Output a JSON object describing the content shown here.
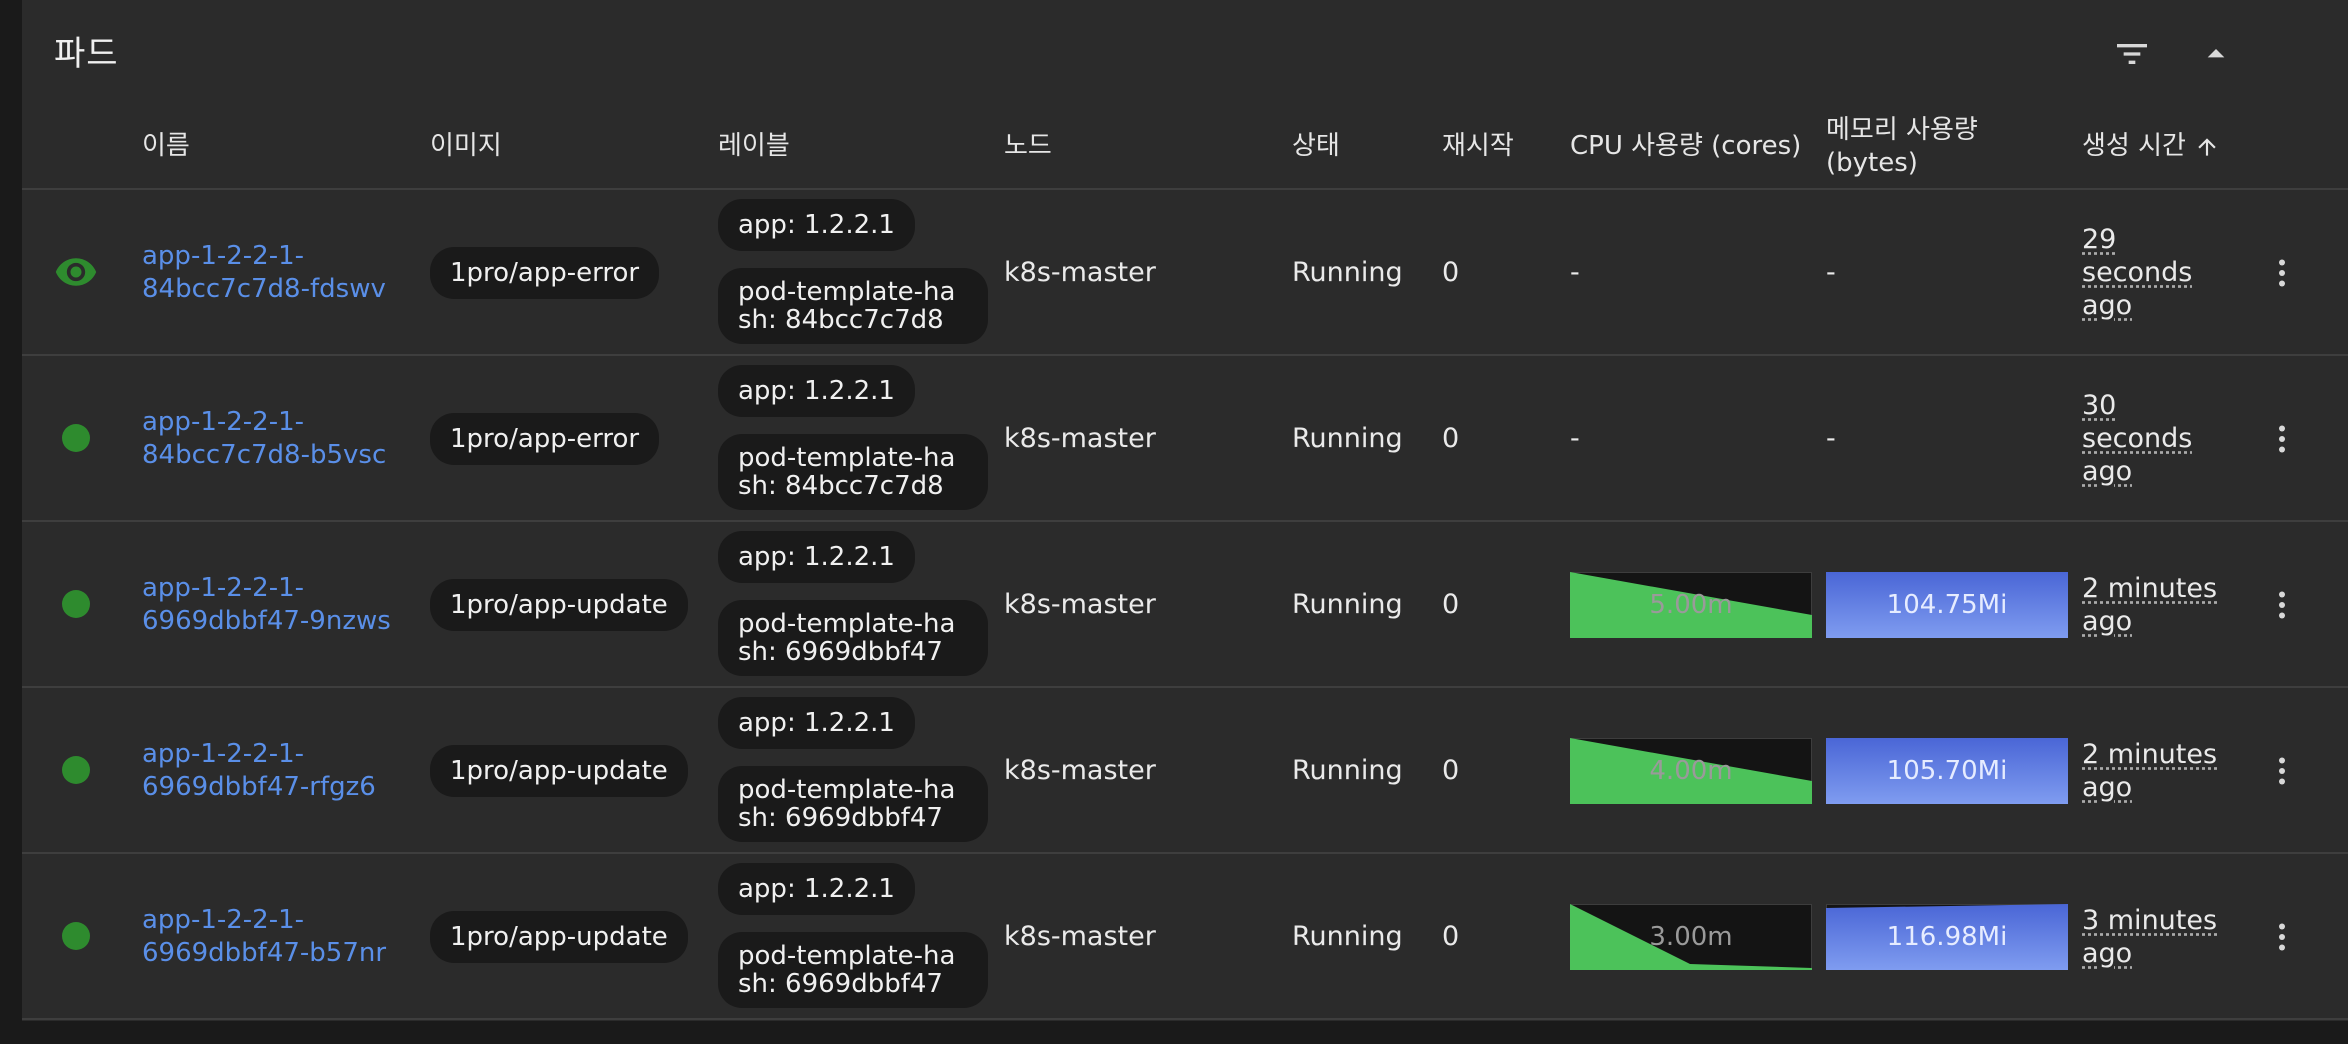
{
  "panel": {
    "title": "파드"
  },
  "header_icons": {
    "filter": "filter-icon",
    "collapse": "chevron-up-icon"
  },
  "columns": {
    "name": "이름",
    "image": "이미지",
    "labels": "레이블",
    "node": "노드",
    "status": "상태",
    "restarts": "재시작",
    "cpu": "CPU 사용량 (cores)",
    "memory_line1": "메모리 사용량",
    "memory_line2": "(bytes)",
    "created": "생성 시간",
    "sort_icon": "arrow-up-icon"
  },
  "colors": {
    "running": "#2e8b2e",
    "link": "#5a8fe8",
    "cpu_fill": "#4cc25a",
    "memory_fill": "#5b79e0",
    "chip_bg": "#1a1a1a"
  },
  "rows": [
    {
      "indicator": "eye-icon",
      "name_line1": "app-1-2-2-1-",
      "name_line2": "84bcc7c7d8-fdswv",
      "image": "1pro/app-error",
      "label_app": "app: 1.2.2.1",
      "label_hash": "pod-template-hash: 84bcc7c7d8",
      "node": "k8s-master",
      "status": "Running",
      "restarts": "0",
      "cpu": "-",
      "memory": "-",
      "created_lines": [
        "29",
        "seconds",
        "ago"
      ]
    },
    {
      "indicator": "status-dot",
      "name_line1": "app-1-2-2-1-",
      "name_line2": "84bcc7c7d8-b5vsc",
      "image": "1pro/app-error",
      "label_app": "app: 1.2.2.1",
      "label_hash": "pod-template-hash: 84bcc7c7d8",
      "node": "k8s-master",
      "status": "Running",
      "restarts": "0",
      "cpu": "-",
      "memory": "-",
      "created_lines": [
        "30",
        "seconds",
        "ago"
      ]
    },
    {
      "indicator": "status-dot",
      "name_line1": "app-1-2-2-1-",
      "name_line2": "6969dbbf47-9nzws",
      "image": "1pro/app-update",
      "label_app": "app: 1.2.2.1",
      "label_hash": "pod-template-hash: 6969dbbf47",
      "node": "k8s-master",
      "status": "Running",
      "restarts": "0",
      "cpu": "5.00m",
      "memory": "104.75Mi",
      "created_lines": [
        "2 minutes",
        "ago"
      ]
    },
    {
      "indicator": "status-dot",
      "name_line1": "app-1-2-2-1-",
      "name_line2": "6969dbbf47-rfgz6",
      "image": "1pro/app-update",
      "label_app": "app: 1.2.2.1",
      "label_hash": "pod-template-hash: 6969dbbf47",
      "node": "k8s-master",
      "status": "Running",
      "restarts": "0",
      "cpu": "4.00m",
      "memory": "105.70Mi",
      "created_lines": [
        "2 minutes",
        "ago"
      ]
    },
    {
      "indicator": "status-dot",
      "name_line1": "app-1-2-2-1-",
      "name_line2": "6969dbbf47-b57nr",
      "image": "1pro/app-update",
      "label_app": "app: 1.2.2.1",
      "label_hash": "pod-template-hash: 6969dbbf47",
      "node": "k8s-master",
      "status": "Running",
      "restarts": "0",
      "cpu": "3.00m",
      "memory": "116.98Mi",
      "created_lines": [
        "3 minutes",
        "ago"
      ]
    }
  ]
}
